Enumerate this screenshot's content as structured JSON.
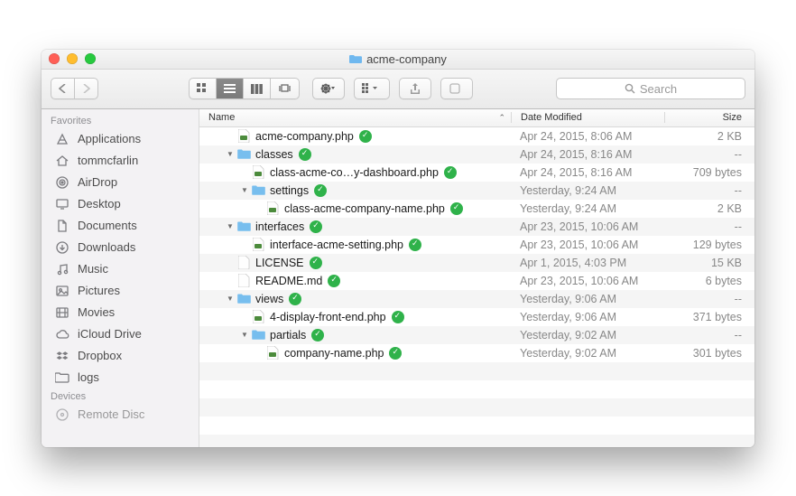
{
  "title": "acme-company",
  "search_placeholder": "Search",
  "sidebar": {
    "sections": [
      {
        "label": "Favorites",
        "items": [
          {
            "icon": "apps",
            "label": "Applications"
          },
          {
            "icon": "home",
            "label": "tommcfarlin"
          },
          {
            "icon": "airdrop",
            "label": "AirDrop"
          },
          {
            "icon": "desktop",
            "label": "Desktop"
          },
          {
            "icon": "doc",
            "label": "Documents"
          },
          {
            "icon": "down",
            "label": "Downloads"
          },
          {
            "icon": "music",
            "label": "Music"
          },
          {
            "icon": "pic",
            "label": "Pictures"
          },
          {
            "icon": "movie",
            "label": "Movies"
          },
          {
            "icon": "cloud",
            "label": "iCloud Drive"
          },
          {
            "icon": "dropbox",
            "label": "Dropbox"
          },
          {
            "icon": "folder",
            "label": "logs"
          }
        ]
      },
      {
        "label": "Devices",
        "items": [
          {
            "icon": "disc",
            "label": "Remote Disc"
          }
        ]
      }
    ]
  },
  "columns": {
    "name": "Name",
    "date": "Date Modified",
    "size": "Size"
  },
  "rows": [
    {
      "indent": 0,
      "arrow": "",
      "kind": "php",
      "name": "acme-company.php",
      "date": "Apr 24, 2015, 8:06 AM",
      "size": "2 KB"
    },
    {
      "indent": 0,
      "arrow": "down",
      "kind": "folder",
      "name": "classes",
      "date": "Apr 24, 2015, 8:16 AM",
      "size": "--"
    },
    {
      "indent": 1,
      "arrow": "",
      "kind": "php",
      "name": "class-acme-co…y-dashboard.php",
      "date": "Apr 24, 2015, 8:16 AM",
      "size": "709 bytes"
    },
    {
      "indent": 1,
      "arrow": "down",
      "kind": "folder",
      "name": "settings",
      "date": "Yesterday, 9:24 AM",
      "size": "--"
    },
    {
      "indent": 2,
      "arrow": "",
      "kind": "php",
      "name": "class-acme-company-name.php",
      "date": "Yesterday, 9:24 AM",
      "size": "2 KB"
    },
    {
      "indent": 0,
      "arrow": "down",
      "kind": "folder",
      "name": "interfaces",
      "date": "Apr 23, 2015, 10:06 AM",
      "size": "--"
    },
    {
      "indent": 1,
      "arrow": "",
      "kind": "php",
      "name": "interface-acme-setting.php",
      "date": "Apr 23, 2015, 10:06 AM",
      "size": "129 bytes"
    },
    {
      "indent": 0,
      "arrow": "",
      "kind": "blank",
      "name": "LICENSE",
      "date": "Apr 1, 2015, 4:03 PM",
      "size": "15 KB"
    },
    {
      "indent": 0,
      "arrow": "",
      "kind": "blank",
      "name": "README.md",
      "date": "Apr 23, 2015, 10:06 AM",
      "size": "6 bytes"
    },
    {
      "indent": 0,
      "arrow": "down",
      "kind": "folder",
      "name": "views",
      "date": "Yesterday, 9:06 AM",
      "size": "--"
    },
    {
      "indent": 1,
      "arrow": "",
      "kind": "php",
      "name": "4-display-front-end.php",
      "date": "Yesterday, 9:06 AM",
      "size": "371 bytes"
    },
    {
      "indent": 1,
      "arrow": "down",
      "kind": "folder",
      "name": "partials",
      "date": "Yesterday, 9:02 AM",
      "size": "--"
    },
    {
      "indent": 2,
      "arrow": "",
      "kind": "php",
      "name": "company-name.php",
      "date": "Yesterday, 9:02 AM",
      "size": "301 bytes"
    }
  ]
}
